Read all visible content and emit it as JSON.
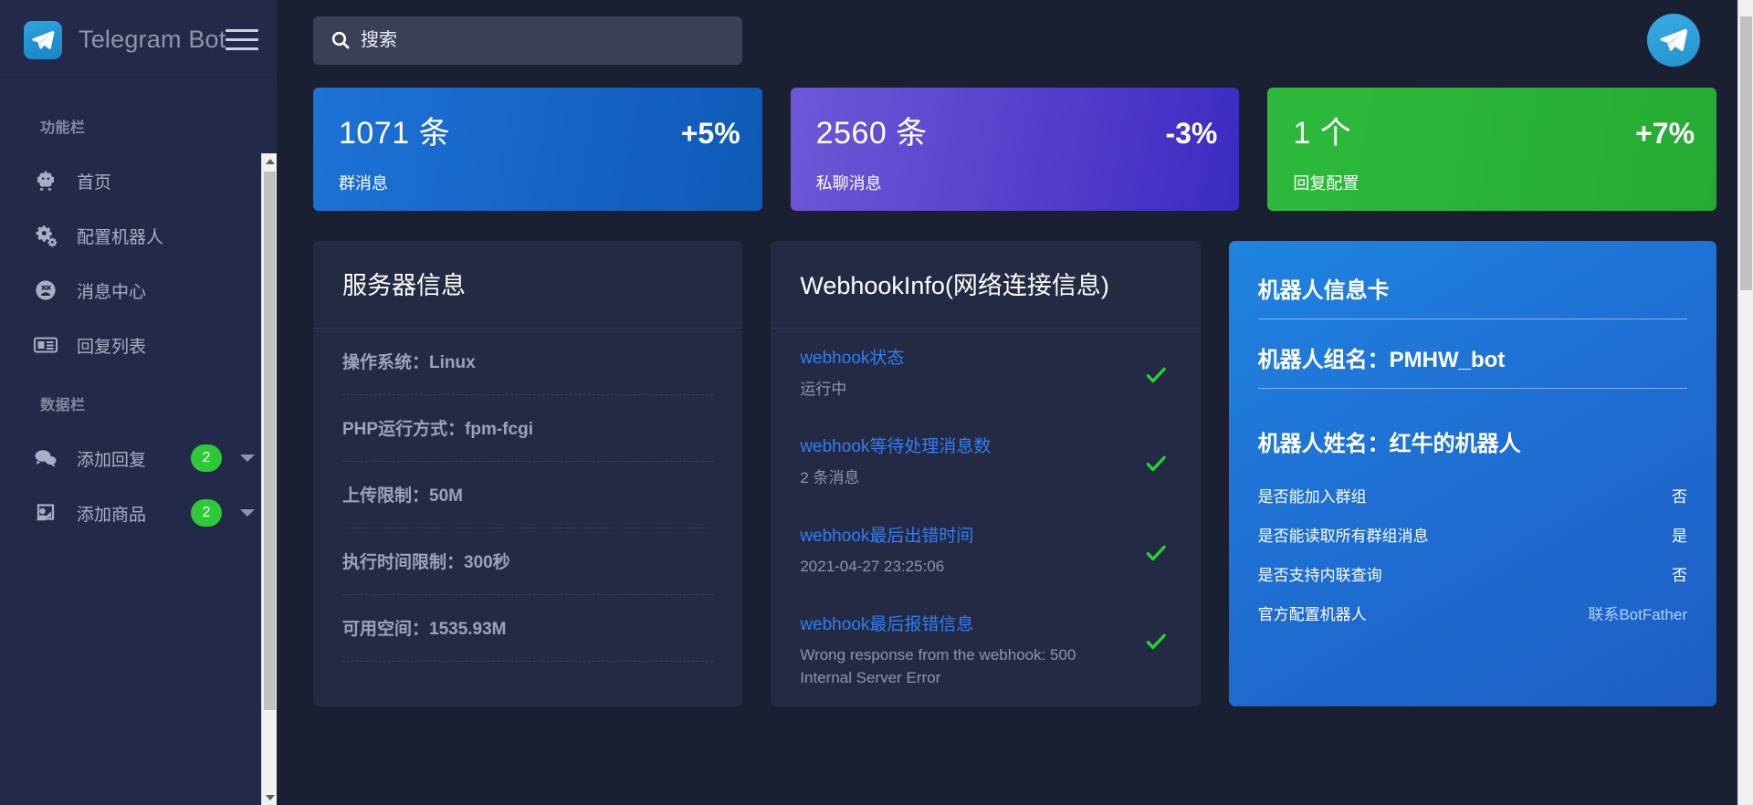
{
  "sidebar": {
    "brand": "Telegram Bot",
    "menu_icon": "hamburger-icon",
    "sections": [
      {
        "title": "功能栏",
        "items": [
          {
            "label": "首页",
            "icon": "robot-icon"
          },
          {
            "label": "配置机器人",
            "icon": "gears-icon"
          },
          {
            "label": "消息中心",
            "icon": "smiley-icon"
          },
          {
            "label": "回复列表",
            "icon": "list-icon"
          }
        ]
      },
      {
        "title": "数据栏",
        "items": [
          {
            "label": "添加回复",
            "icon": "chat-bubbles-icon",
            "badge": "2",
            "caret": true
          },
          {
            "label": "添加商品",
            "icon": "user-board-icon",
            "badge": "2",
            "caret": true
          }
        ]
      }
    ]
  },
  "topbar": {
    "search_placeholder": "搜索",
    "search_value": "",
    "search_icon": "search-icon",
    "avatar_icon": "telegram-icon"
  },
  "stats": [
    {
      "value": "1071 条",
      "delta": "+5%",
      "label": "群消息",
      "color": "#1d72d6"
    },
    {
      "value": "2560 条",
      "delta": "-3%",
      "label": "私聊消息",
      "color": "#6f57d6"
    },
    {
      "value": "1 个",
      "delta": "+7%",
      "label": "回复配置",
      "color": "#2dba3c"
    }
  ],
  "server_panel": {
    "title": "服务器信息",
    "rows": [
      "操作系统：Linux",
      "PHP运行方式：fpm-fcgi",
      "上传限制：50M",
      "执行时间限制：300秒",
      "可用空间：1535.93M"
    ]
  },
  "webhook_panel": {
    "title": "WebhookInfo(网络连接信息)",
    "rows": [
      {
        "key": "webhook状态",
        "value": "运行中",
        "status": "ok"
      },
      {
        "key": "webhook等待处理消息数",
        "value": "2 条消息",
        "status": "ok"
      },
      {
        "key": "webhook最后出错时间",
        "value": "2021-04-27 23:25:06",
        "status": "ok"
      },
      {
        "key": "webhook最后报错信息",
        "value": "Wrong response from the webhook: 500 Internal Server Error",
        "status": "ok"
      }
    ]
  },
  "bot_card": {
    "heading": "机器人信息卡",
    "group_name_label": "机器人组名：PMHW_bot",
    "bot_name_label": "机器人姓名：红牛的机器人",
    "rows": [
      {
        "key": "是否能加入群组",
        "value": "否",
        "link": false
      },
      {
        "key": "是否能读取所有群组消息",
        "value": "是",
        "link": false
      },
      {
        "key": "是否支持内联查询",
        "value": "否",
        "link": false
      },
      {
        "key": "官方配置机器人",
        "value": "联系BotFather",
        "link": true
      }
    ]
  }
}
